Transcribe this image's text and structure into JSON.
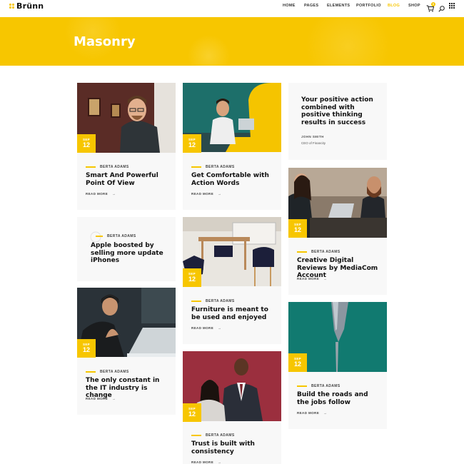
{
  "header": {
    "logo": "Brünn",
    "nav": [
      "HOME",
      "PAGES",
      "ELEMENTS",
      "PORTFOLIO",
      "BLOG",
      "SHOP"
    ],
    "active_nav": "BLOG",
    "cart_count": "0",
    "icons": [
      "cart-icon",
      "search-icon",
      "apps-grid-icon"
    ]
  },
  "hero": {
    "title": "Masonry"
  },
  "colors": {
    "accent": "#f7c600",
    "card_bg": "#f8f8f8",
    "text": "#111111"
  },
  "posts": [
    {
      "month": "SEP",
      "day": "12",
      "author": "BERTA ADAMS",
      "title": "Smart And Powerful Point Of View",
      "more": "READ MORE"
    },
    {
      "author": "BERTA ADAMS",
      "title": "Apple boosted by selling more update iPhones"
    },
    {
      "month": "SEP",
      "day": "12",
      "author": "BERTA ADAMS",
      "title": "The only constant in the IT industry is change",
      "more": "READ MORE"
    },
    {
      "month": "SEP",
      "day": "12",
      "author": "BERTA ADAMS",
      "title": "Get Comfortable with Action Words",
      "more": "READ MORE"
    },
    {
      "month": "SEP",
      "day": "12",
      "author": "BERTA ADAMS",
      "title": "Furniture is meant to be used and enjoyed",
      "more": "READ MORE"
    },
    {
      "month": "SEP",
      "day": "12",
      "author": "BERTA ADAMS",
      "title": "Trust is built with consistency",
      "more": "READ MORE"
    },
    {
      "quote": "Your positive action combined with positive thinking results in success",
      "author": "JOHN SMITH",
      "role": "CEO of Financity"
    },
    {
      "month": "SEP",
      "day": "12",
      "author": "BERTA ADAMS",
      "title": "Creative Digital Reviews by MediaCom Account",
      "more": "READ MORE"
    },
    {
      "month": "SEP",
      "day": "12",
      "author": "BERTA ADAMS",
      "title": "Build the roads and the jobs follow",
      "more": "READ MORE"
    }
  ]
}
